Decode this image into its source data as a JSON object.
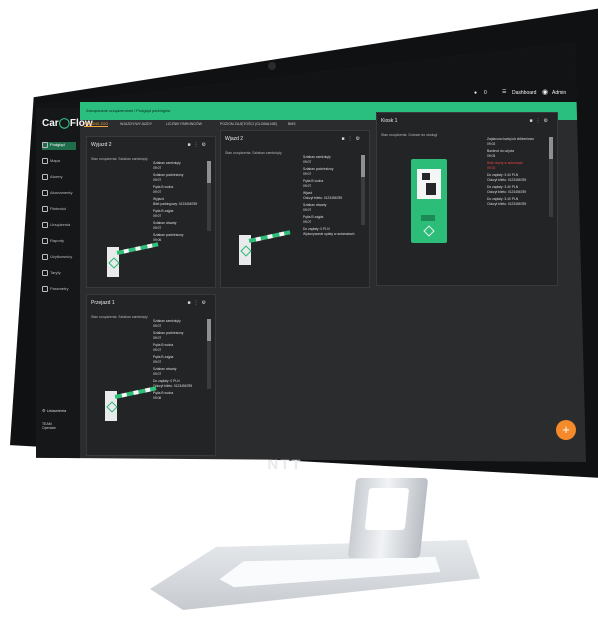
{
  "device": {
    "brand": "NTT"
  },
  "app": {
    "logo": {
      "car": "Car",
      "flow": "Flow"
    },
    "topbar": {
      "notification_count": "0",
      "dashboard_label": "Dashboard",
      "user_label": "Admin"
    },
    "breadcrumb": "Zarządzanie urządzeniami / Podgląd parkingów",
    "tabs": [
      {
        "label": "PARKING ZOO",
        "active": true
      },
      {
        "label": "WJAZDY/WYJAZDY",
        "active": false
      },
      {
        "label": "LICZNIK PARKINGÓW",
        "active": false
      },
      {
        "label": "POZIOM ZAJĘTOŚCI (GLOBALNIE)",
        "active": false
      },
      {
        "label": "BMS",
        "active": false
      }
    ],
    "sidebar": [
      {
        "label": "Podgląd",
        "icon": "eye-icon",
        "active": true
      },
      {
        "label": "Mapa",
        "icon": "map-icon",
        "active": false
      },
      {
        "label": "Alarmy",
        "icon": "bell-icon",
        "active": false
      },
      {
        "label": "Abonamenty",
        "icon": "card-icon",
        "active": false
      },
      {
        "label": "Płatności",
        "icon": "payment-icon",
        "active": false
      },
      {
        "label": "Urządzenia",
        "icon": "device-icon",
        "active": false
      },
      {
        "label": "Raporty",
        "icon": "report-icon",
        "active": false
      },
      {
        "label": "Użytkownicy",
        "icon": "users-icon",
        "active": false
      },
      {
        "label": "Taryfy",
        "icon": "tariff-icon",
        "active": false
      },
      {
        "label": "Parametry",
        "icon": "params-icon",
        "active": false
      }
    ],
    "settings_label": "Ustawienia",
    "user": {
      "name": "TEAM",
      "role": "Operator"
    },
    "panels": [
      {
        "title": "Wyjazd 2",
        "status": "Stan urządzenia: Szlaban zamknięty",
        "events": [
          {
            "text": "Szlaban zamknięty",
            "time": "09:07",
            "red": false
          },
          {
            "text": "Szlaban podniesiony",
            "time": "09:07",
            "red": false
          },
          {
            "text": "Pętla B wolna",
            "time": "09:07",
            "red": false
          },
          {
            "text": "Wyjazd",
            "time": "Bilet parkingowy: 0123456789",
            "red": false
          },
          {
            "text": "Pętla B zajęta",
            "time": "09:07",
            "red": false
          },
          {
            "text": "Szlaban otwarty",
            "time": "09:07",
            "red": false
          },
          {
            "text": "Szlaban podniesiony",
            "time": "09:06",
            "red": false
          }
        ]
      },
      {
        "title": "Wjazd 2",
        "status": "Stan urządzenia: Szlaban zamknięty",
        "events": [
          {
            "text": "Szlaban zamknięty",
            "time": "09:07",
            "red": false
          },
          {
            "text": "Szlaban podniesiony",
            "time": "09:07",
            "red": false
          },
          {
            "text": "Pętla B wolna",
            "time": "09:07",
            "red": false
          },
          {
            "text": "Wjazd",
            "time": "Odczyt biletu: 0123456789",
            "red": false
          },
          {
            "text": "Szlaban otwarty",
            "time": "09:07",
            "red": false
          },
          {
            "text": "Pętla B zajęta",
            "time": "09:07",
            "red": false
          },
          {
            "text": "Do zapłaty: 0 PLN",
            "time": "Wykonywanie opłaty w automatach",
            "red": false
          }
        ]
      },
      {
        "title": "Kiosk 1",
        "status": "Stan urządzenia: Gotowe do obsługi",
        "events": [
          {
            "text": "Zapłacono kartą lub zbliżeniowo",
            "time": "09:03",
            "red": false
          },
          {
            "text": "Banknot do użycia",
            "time": "09:03",
            "red": false
          },
          {
            "text": "Brak reszty w automacie",
            "time": "09:03",
            "red": true
          },
          {
            "text": "Do zapłaty: 3.40 PLN",
            "time": "Odczyt biletu: 0123456789",
            "red": false
          },
          {
            "text": "Do zapłaty: 3.40 PLN",
            "time": "Odczyt biletu: 0123456789",
            "red": false
          },
          {
            "text": "Do zapłaty: 3.40 PLN",
            "time": "Odczyt biletu: 0123456789",
            "red": false
          }
        ]
      },
      {
        "title": "Przejazd 1",
        "status": "Stan urządzenia: Szlaban zamknięty",
        "events": [
          {
            "text": "Szlaban zamknięty",
            "time": "09:07",
            "red": false
          },
          {
            "text": "Szlaban podniesiony",
            "time": "09:07",
            "red": false
          },
          {
            "text": "Pętla B wolna",
            "time": "09:07",
            "red": false
          },
          {
            "text": "Pętla B zajęta",
            "time": "09:07",
            "red": false
          },
          {
            "text": "Szlaban otwarty",
            "time": "09:07",
            "red": false
          },
          {
            "text": "Do zapłaty: 0 PLN",
            "time": "Odczyt biletu: 0123456789",
            "red": false
          },
          {
            "text": "Pętla B wolna",
            "time": "09:06",
            "red": false
          }
        ]
      }
    ],
    "fab_label": "+"
  }
}
